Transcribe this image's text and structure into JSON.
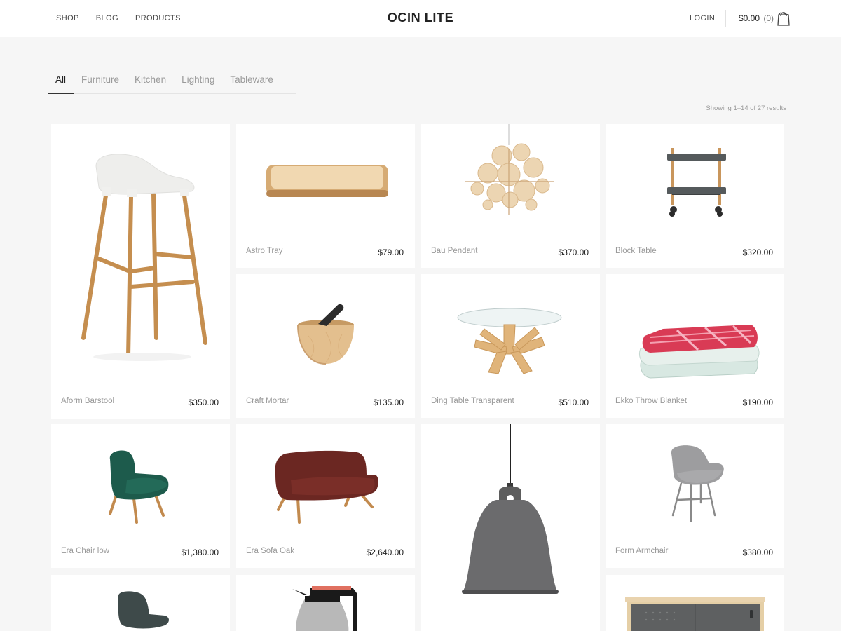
{
  "header": {
    "nav": [
      "SHOP",
      "BLOG",
      "PRODUCTS"
    ],
    "brand": "OCIN LITE",
    "login": "LOGIN",
    "cart_total": "$0.00",
    "cart_count": "(0)",
    "cart_icon": "shopping-bag-icon"
  },
  "filters": {
    "tabs": [
      "All",
      "Furniture",
      "Kitchen",
      "Lighting",
      "Tableware"
    ],
    "active": "All"
  },
  "results_text": "Showing 1–14 of 27 results",
  "products": [
    {
      "name": "Aform Barstool",
      "price": "$350.00"
    },
    {
      "name": "Astro Tray",
      "price": "$79.00"
    },
    {
      "name": "Bau Pendant",
      "price": "$370.00"
    },
    {
      "name": "Block Table",
      "price": "$320.00"
    },
    {
      "name": "Craft Mortar",
      "price": "$135.00"
    },
    {
      "name": "Ding Table Transparent",
      "price": "$510.00"
    },
    {
      "name": "Ekko Throw Blanket",
      "price": "$190.00"
    },
    {
      "name": "Era Chair low",
      "price": "$1,380.00"
    },
    {
      "name": "Era Sofa Oak",
      "price": "$2,640.00"
    },
    {
      "name": "Form Armchair",
      "price": "$380.00"
    }
  ]
}
